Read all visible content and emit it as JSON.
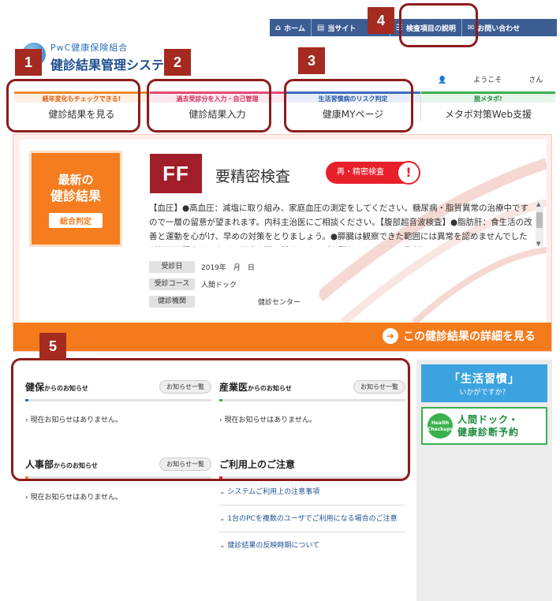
{
  "topnav": {
    "home": "ホーム",
    "sitemap": "当サイト",
    "checkup_items": "検査項目の説明",
    "contact": "お問い合わせ"
  },
  "logo": {
    "org": "PwC健康保険組合",
    "system": "健診結果管理システム"
  },
  "welcome": {
    "prefix": "ようこそ",
    "suffix": "さん"
  },
  "tabs": [
    {
      "sub": "経年変化もチェックできる!",
      "label": "健診結果を見る"
    },
    {
      "sub": "過去受診分を入力・自己管理",
      "label": "健診結果入力"
    },
    {
      "sub": "生活習慣病のリスク判定",
      "label": "健康MYページ"
    },
    {
      "sub": "脱メタボ!",
      "label": "メタボ対策Web支援"
    }
  ],
  "hero": {
    "latest_line1": "最新の",
    "latest_line2": "健診結果",
    "overall_button": "総合判定",
    "grade": "FF",
    "judgement": "要精密検査",
    "pill": "再・精密検査",
    "pill_mark": "!",
    "advice": "【血圧】●高血圧：減塩に取り組み、家庭血圧の測定をしてください。糖尿病・脂質異常の治療中ですので一層の留意が望まれます。内科主治医にご相談ください。【腹部超音波検査】●脂肪肝：食生活の改善と運動を心がけ、早めの対策をとりましょう。●膵臓は観察できた範囲には異常を認めませんでしたが体型や腸内ガスなどで観察し難い臓器です。ご心配なようでしたら腹部CT",
    "info": [
      {
        "key": "受診日",
        "value": "2019年　月　日"
      },
      {
        "key": "受診コース",
        "value": "人間ドック"
      },
      {
        "key": "健診機関",
        "value": "健診センター"
      }
    ],
    "detail_link": "この健診結果の詳細を見る"
  },
  "news": [
    {
      "title": "健保",
      "suffix": "からのお知らせ",
      "button": "お知らせ一覧",
      "message": "現在お知らせはありません。",
      "accent": "#2a6fb8"
    },
    {
      "title": "産業医",
      "suffix": "からのお知らせ",
      "button": "お知らせ一覧",
      "message": "現在お知らせはありません。",
      "accent": "#3bb14e"
    },
    {
      "title": "人事部",
      "suffix": "からのお知らせ",
      "button": "お知らせ一覧",
      "message": "現在お知らせはありません。",
      "accent": "#f08a2c"
    }
  ],
  "notice": {
    "title": "ご利用上のご注意",
    "accent": "#e8202c",
    "links": [
      "システムご利用上の注意事項",
      "1台のPCを複数のユーザでご利用になる場合のご注意",
      "健診結果の反映時期について"
    ]
  },
  "side": {
    "banner1_line1": "「生活習慣」",
    "banner1_line2": "いかがですか？",
    "banner2_line1": "人間ドック・",
    "banner2_line2": "健康診断予約",
    "banner2_logo": "Health Checkups"
  },
  "annotations": [
    "1",
    "2",
    "3",
    "4",
    "5"
  ]
}
